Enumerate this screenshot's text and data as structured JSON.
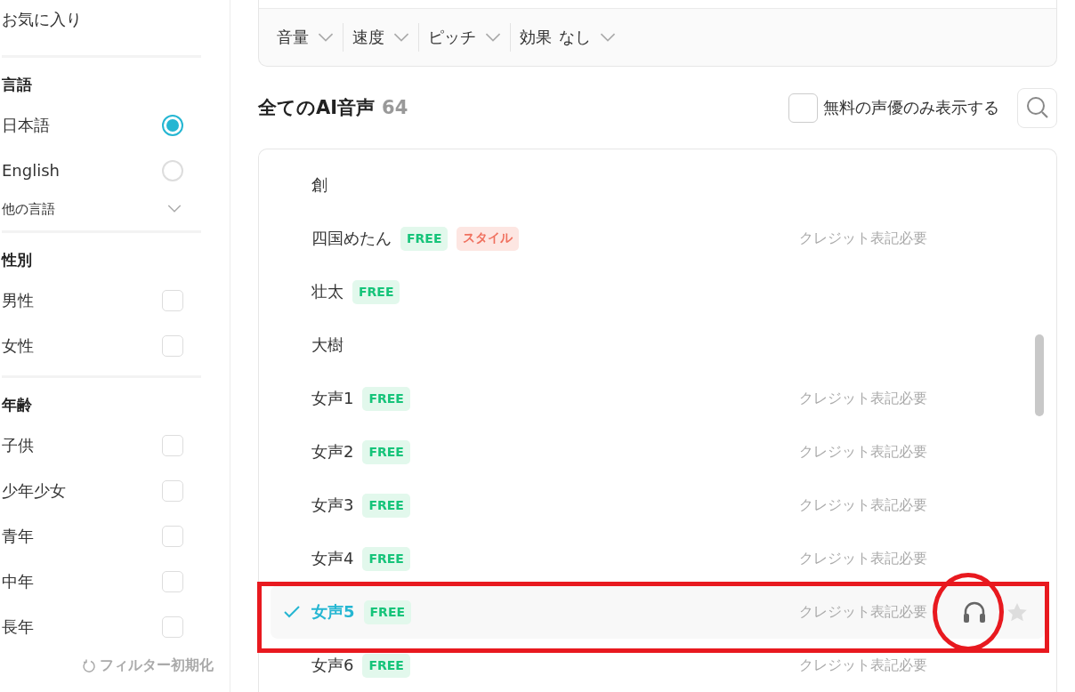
{
  "sidebar": {
    "favorites": "お気に入り",
    "language": {
      "title": "言語",
      "options": [
        {
          "label": "日本語",
          "selected": true
        },
        {
          "label": "English",
          "selected": false
        }
      ],
      "more": "他の言語"
    },
    "gender": {
      "title": "性別",
      "options": [
        {
          "label": "男性",
          "checked": false
        },
        {
          "label": "女性",
          "checked": false
        }
      ]
    },
    "age": {
      "title": "年齢",
      "options": [
        {
          "label": "子供",
          "checked": false
        },
        {
          "label": "少年少女",
          "checked": false
        },
        {
          "label": "青年",
          "checked": false
        },
        {
          "label": "中年",
          "checked": false
        },
        {
          "label": "長年",
          "checked": false
        }
      ]
    },
    "reset": "フィルター初期化"
  },
  "controls": [
    {
      "label": "音量"
    },
    {
      "label": "速度"
    },
    {
      "label": "ピッチ"
    },
    {
      "label": "効果",
      "value": "なし"
    }
  ],
  "list_header": {
    "title": "全てのAI音声",
    "count": "64",
    "free_only": {
      "label": "無料の声優のみ表示する",
      "checked": false
    }
  },
  "voices": [
    {
      "name": "創",
      "selected": false
    },
    {
      "name": "四国めたん",
      "tags": [
        {
          "kind": "free",
          "label": "FREE"
        },
        {
          "kind": "style",
          "label": "スタイル"
        }
      ],
      "credit": "クレジット表記必要",
      "selected": false
    },
    {
      "name": "壮太",
      "tags": [
        {
          "kind": "free",
          "label": "FREE"
        }
      ],
      "selected": false
    },
    {
      "name": "大樹",
      "selected": false
    },
    {
      "name": "女声1",
      "tags": [
        {
          "kind": "free",
          "label": "FREE"
        }
      ],
      "credit": "クレジット表記必要",
      "selected": false
    },
    {
      "name": "女声2",
      "tags": [
        {
          "kind": "free",
          "label": "FREE"
        }
      ],
      "credit": "クレジット表記必要",
      "selected": false
    },
    {
      "name": "女声3",
      "tags": [
        {
          "kind": "free",
          "label": "FREE"
        }
      ],
      "credit": "クレジット表記必要",
      "selected": false
    },
    {
      "name": "女声4",
      "tags": [
        {
          "kind": "free",
          "label": "FREE"
        }
      ],
      "credit": "クレジット表記必要",
      "selected": false
    },
    {
      "name": "女声5",
      "tags": [
        {
          "kind": "free",
          "label": "FREE"
        }
      ],
      "credit": "クレジット表記必要",
      "selected": true
    },
    {
      "name": "女声6",
      "tags": [
        {
          "kind": "free",
          "label": "FREE"
        }
      ],
      "credit": "クレジット表記必要",
      "selected": false
    }
  ]
}
